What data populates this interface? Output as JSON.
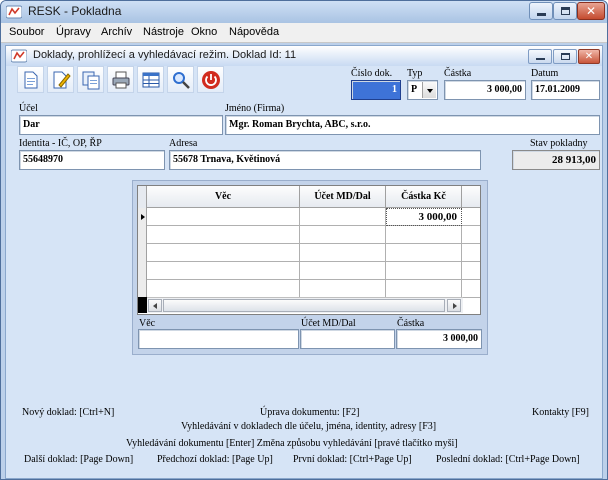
{
  "app": {
    "title": "RESK  - Pokladna"
  },
  "menu": [
    "Soubor",
    "Úpravy",
    "Archív",
    "Nástroje",
    "Okno",
    "Nápověda"
  ],
  "child": {
    "title": "Doklady, prohlížecí a vyhledávací režim. Doklad Id: 11"
  },
  "toolbar": {
    "icons": [
      "new-doc-icon",
      "edit-doc-icon",
      "copy-doc-icon",
      "print-icon",
      "table-icon",
      "search-icon",
      "power-icon"
    ],
    "colors": {
      "power": "#d12b1f",
      "search": "#2f6fd0"
    }
  },
  "header": {
    "doc_num_label": "Číslo dok.",
    "doc_num_value": "1",
    "type_label": "Typ",
    "type_value": "P",
    "amount_label": "Částka",
    "amount_value": "3 000,00",
    "date_label": "Datum",
    "date_value": "17.01.2009"
  },
  "form": {
    "purpose_label": "Účel",
    "purpose_value": "Dar",
    "name_label": "Jméno (Firma)",
    "name_value": "Mgr. Roman Brychta, ABC, s.r.o.",
    "identity_label": "Identita - IČ, OP, ŘP",
    "identity_value": "55648970",
    "address_label": "Adresa",
    "address_value": "55678 Trnava, Květinová",
    "balance_label": "Stav pokladny",
    "balance_value": "28 913,00"
  },
  "grid": {
    "columns": [
      "Věc",
      "Účet MD/Dal",
      "Částka Kč"
    ],
    "rows": [
      {
        "vec": "",
        "ucet": "",
        "castka": "3 000,00"
      },
      {
        "vec": "",
        "ucet": "",
        "castka": ""
      },
      {
        "vec": "",
        "ucet": "",
        "castka": ""
      },
      {
        "vec": "",
        "ucet": "",
        "castka": ""
      },
      {
        "vec": "",
        "ucet": "",
        "castka": ""
      }
    ]
  },
  "detail": {
    "vec_label": "Věc",
    "vec_value": "",
    "ucet_label": "Účet MD/Dal",
    "ucet_value": "",
    "castka_label": "Částka",
    "castka_value": "3 000,00"
  },
  "hints": {
    "new": "Nový doklad: [Ctrl+N]",
    "edit": "Úprava dokumentu: [F2]",
    "contacts": "Kontakty [F9]",
    "search_docs": "Vyhledávání v dokladech dle účelu, jména, identity, adresy [F3]",
    "search_enter": "Vyhledávání dokumentu [Enter]  Změna způsobu vyhledávání [pravé tlačítko myši]",
    "next": "Další doklad: [Page Down]",
    "prev": "Předchozí doklad: [Page Up]",
    "first": "První doklad: [Ctrl+Page Up]",
    "last": "Poslední doklad: [Ctrl+Page Down]"
  }
}
